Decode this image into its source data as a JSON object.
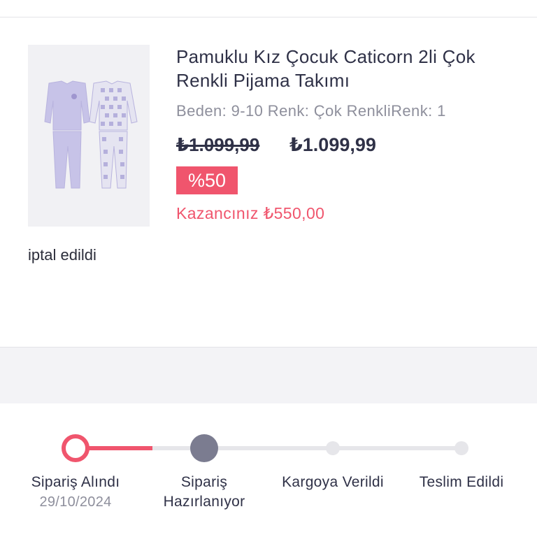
{
  "product": {
    "title": "Pamuklu Kız Çocuk Caticorn 2li Çok Renkli Pijama Takımı",
    "variant": "Beden: 9-10 Renk: Çok RenkliRenk: 1",
    "old_price": "₺1.099,99",
    "new_price": "₺1.099,99",
    "discount": "%50",
    "savings": "Kazancınız ₺550,00",
    "image_icon": "pajama-set-image"
  },
  "status": {
    "text": "iptal edildi"
  },
  "tracker": {
    "steps": [
      {
        "label": "Sipariş Alındı",
        "date": "29/10/2024",
        "state": "done"
      },
      {
        "label": "Sipariş Hazırlanıyor",
        "state": "current"
      },
      {
        "label": "Kargoya Verildi",
        "state": "pending"
      },
      {
        "label": "Teslim Edildi",
        "state": "pending"
      }
    ],
    "progress_fraction": 0.2
  },
  "colors": {
    "accent": "#f0556d",
    "text_primary": "#2f3147",
    "text_secondary": "#8e8f9c",
    "inactive_track": "#e6e6ea",
    "current_step": "#7b7c90"
  }
}
